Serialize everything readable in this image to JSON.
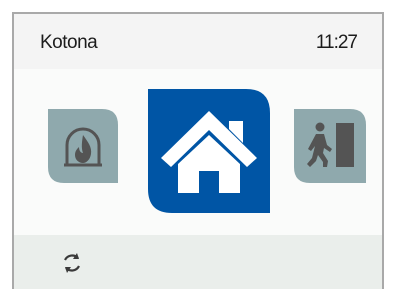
{
  "header": {
    "title": "Kotona",
    "time": "11:27"
  },
  "modes": [
    {
      "id": "fireplace",
      "icon": "fireplace-icon",
      "selected": false
    },
    {
      "id": "home",
      "icon": "home-icon",
      "selected": true
    },
    {
      "id": "away",
      "icon": "away-icon",
      "selected": false
    }
  ],
  "footer": {
    "icon": "refresh-icon"
  },
  "colors": {
    "accent": "#0055a5",
    "tile_inactive": "#8fa9ad",
    "icon_inactive": "#545454",
    "header_bg": "#f4f4f4",
    "footer_bg": "#eaeeeb"
  }
}
